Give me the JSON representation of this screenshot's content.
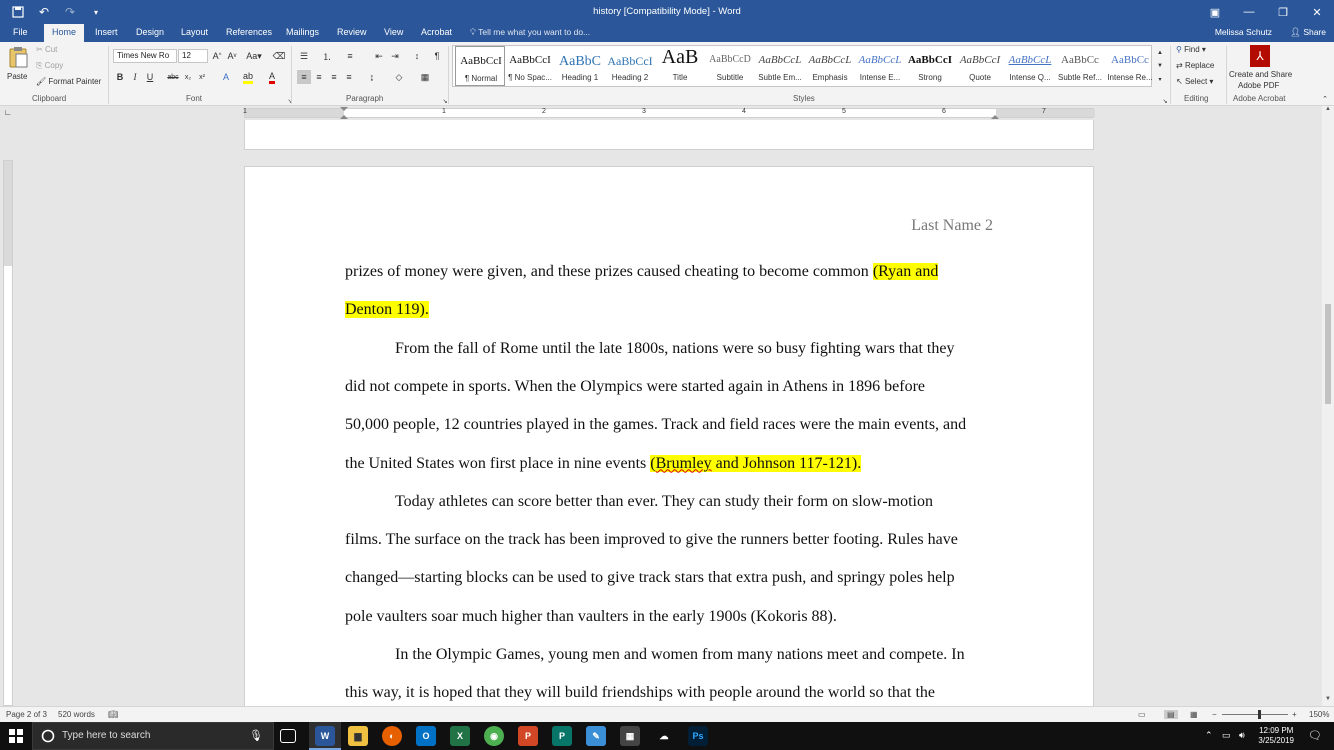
{
  "app": {
    "title": "history [Compatibility Mode] - Word",
    "user": "Melissa Schutz",
    "share": "Share"
  },
  "tabs": [
    "File",
    "Home",
    "Insert",
    "Design",
    "Layout",
    "References",
    "Mailings",
    "Review",
    "View",
    "Acrobat"
  ],
  "tell_me": "Tell me what you want to do...",
  "clipboard": {
    "paste": "Paste",
    "cut": "Cut",
    "copy": "Copy",
    "format_painter": "Format Painter",
    "label": "Clipboard"
  },
  "font": {
    "name": "Times New Ro",
    "size": "12",
    "label": "Font"
  },
  "paragraph": {
    "label": "Paragraph"
  },
  "styles": {
    "label": "Styles",
    "items": [
      {
        "sample": "AaBbCcI",
        "name": "¶ Normal"
      },
      {
        "sample": "AaBbCcI",
        "name": "¶ No Spac..."
      },
      {
        "sample": "AaBbC",
        "name": "Heading 1"
      },
      {
        "sample": "AaBbCcI",
        "name": "Heading 2"
      },
      {
        "sample": "AaB",
        "name": "Title"
      },
      {
        "sample": "AaBbCcD",
        "name": "Subtitle"
      },
      {
        "sample": "AaBbCcL",
        "name": "Subtle Em..."
      },
      {
        "sample": "AaBbCcL",
        "name": "Emphasis"
      },
      {
        "sample": "AaBbCcL",
        "name": "Intense E..."
      },
      {
        "sample": "AaBbCcI",
        "name": "Strong"
      },
      {
        "sample": "AaBbCcI",
        "name": "Quote"
      },
      {
        "sample": "AaBbCcL",
        "name": "Intense Q..."
      },
      {
        "sample": "AaBbCc",
        "name": "Subtle Ref..."
      },
      {
        "sample": "AaBbCc",
        "name": "Intense Re..."
      }
    ]
  },
  "editing": {
    "find": "Find",
    "replace": "Replace",
    "select": "Select",
    "label": "Editing"
  },
  "acrobat": {
    "create": "Create and Share",
    "adobe_pdf": "Adobe PDF",
    "label": "Adobe Acrobat"
  },
  "ruler": {
    "numbers": [
      "1",
      "1",
      "2",
      "3",
      "4",
      "5",
      "6",
      "7"
    ]
  },
  "document": {
    "header": "Last Name 2",
    "lines": [
      {
        "parts": [
          {
            "t": "prizes of money were given, and these prizes caused cheating to become common "
          },
          {
            "t": "(Ryan and",
            "hl": true
          }
        ]
      },
      {
        "parts": [
          {
            "t": "Denton 119).",
            "hl": true
          }
        ]
      },
      {
        "indent": true,
        "parts": [
          {
            "t": "From the fall of Rome until the late 1800s, nations were so busy fighting wars that they"
          }
        ]
      },
      {
        "parts": [
          {
            "t": "did not compete in sports. When the Olympics were started again in Athens in 1896 before"
          }
        ]
      },
      {
        "parts": [
          {
            "t": "50,000 people, 12 countries played in the games. Track and field races were the main events, and"
          }
        ]
      },
      {
        "parts": [
          {
            "t": "the United States won first place in nine events "
          },
          {
            "t": "(",
            "hl": true
          },
          {
            "t": "Brumley",
            "hl": true,
            "sq": true
          },
          {
            "t": " and Johnson 117-121).",
            "hl": true
          }
        ]
      },
      {
        "indent": true,
        "parts": [
          {
            "t": "Today athletes can score better than ever. They can study their form on slow-motion"
          }
        ]
      },
      {
        "parts": [
          {
            "t": "films. The surface on the track has been improved to give the runners better footing. Rules have"
          }
        ]
      },
      {
        "parts": [
          {
            "t": "changed—starting blocks can be used to give track stars that extra push, and springy poles help"
          }
        ]
      },
      {
        "parts": [
          {
            "t": "pole vaulters soar much higher than vaulters in the early 1900s (Kokoris 88)."
          }
        ]
      },
      {
        "indent": true,
        "parts": [
          {
            "t": "In the Olympic Games, young men and women from many nations meet and compete. In"
          }
        ]
      },
      {
        "parts": [
          {
            "t": "this way, it is hoped that they will build friendships with people around the world so that the"
          }
        ]
      }
    ]
  },
  "status": {
    "page": "Page 2 of 3",
    "words": "520 words",
    "zoom": "150%"
  },
  "taskbar": {
    "search_placeholder": "Type here to search",
    "time": "12:09 PM",
    "date": "3/25/2019"
  }
}
